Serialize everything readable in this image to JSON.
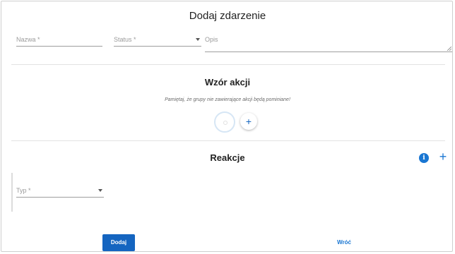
{
  "form": {
    "title": "Dodaj zdarzenie",
    "name_label": "Nazwa *",
    "status_label": "Status *",
    "description_label": "Opis"
  },
  "pattern": {
    "title": "Wzór akcji",
    "note": "Pamiętaj, że grupy nie zawierające akcji będą pominiane!",
    "add_symbol": "+"
  },
  "reactions": {
    "title": "Reakcje",
    "info_symbol": "i",
    "add_symbol": "+",
    "type_label": "Typ *"
  },
  "actions": {
    "submit_label": "Dodaj",
    "back_label": "Wróć"
  },
  "colors": {
    "primary": "#1976d2",
    "primary_dark": "#1565c0"
  }
}
